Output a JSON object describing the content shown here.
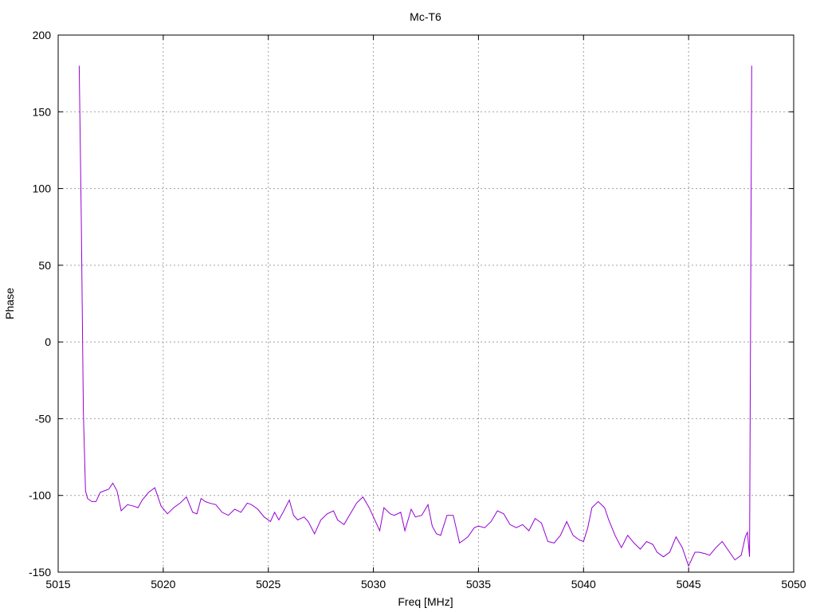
{
  "chart_data": {
    "type": "line",
    "title": "Mc-T6",
    "xlabel": "Freq [MHz]",
    "ylabel": "Phase",
    "xlim": [
      5015,
      5050
    ],
    "ylim": [
      -150,
      200
    ],
    "xticks": [
      5015,
      5020,
      5025,
      5030,
      5035,
      5040,
      5045,
      5050
    ],
    "yticks": [
      -150,
      -100,
      -50,
      0,
      50,
      100,
      150,
      200
    ],
    "grid": true,
    "legend": "none",
    "series": [
      {
        "color": "#9400d3",
        "x": [
          5016.0,
          5016.1,
          5016.2,
          5016.3,
          5016.4,
          5016.6,
          5016.8,
          5017.0,
          5017.2,
          5017.4,
          5017.6,
          5017.8,
          5018.0,
          5018.3,
          5018.6,
          5018.8,
          5019.0,
          5019.3,
          5019.6,
          5019.9,
          5020.2,
          5020.5,
          5020.8,
          5021.1,
          5021.4,
          5021.6,
          5021.8,
          5022.0,
          5022.2,
          5022.5,
          5022.8,
          5023.1,
          5023.4,
          5023.7,
          5024.0,
          5024.2,
          5024.5,
          5024.8,
          5025.1,
          5025.3,
          5025.5,
          5025.7,
          5026.0,
          5026.2,
          5026.4,
          5026.7,
          5026.9,
          5027.2,
          5027.5,
          5027.8,
          5028.1,
          5028.3,
          5028.6,
          5028.9,
          5029.2,
          5029.5,
          5029.8,
          5030.0,
          5030.3,
          5030.5,
          5030.8,
          5031.0,
          5031.3,
          5031.5,
          5031.8,
          5032.0,
          5032.3,
          5032.6,
          5032.8,
          5033.0,
          5033.2,
          5033.5,
          5033.8,
          5034.1,
          5034.3,
          5034.5,
          5034.8,
          5035.0,
          5035.3,
          5035.6,
          5035.9,
          5036.2,
          5036.5,
          5036.8,
          5037.1,
          5037.4,
          5037.7,
          5038.0,
          5038.3,
          5038.6,
          5038.9,
          5039.2,
          5039.5,
          5039.8,
          5040.0,
          5040.2,
          5040.4,
          5040.7,
          5041.0,
          5041.2,
          5041.5,
          5041.8,
          5042.1,
          5042.4,
          5042.7,
          5043.0,
          5043.3,
          5043.5,
          5043.8,
          5044.1,
          5044.4,
          5044.7,
          5045.0,
          5045.3,
          5045.5,
          5045.8,
          5046.0,
          5046.3,
          5046.6,
          5046.9,
          5047.2,
          5047.5,
          5047.7,
          5047.8,
          5047.9,
          5048.0
        ],
        "y": [
          180,
          80,
          -45,
          -97,
          -102,
          -104,
          -104,
          -98,
          -97,
          -96,
          -92,
          -97,
          -110,
          -106,
          -107,
          -108,
          -103,
          -98,
          -95,
          -107,
          -112,
          -108,
          -105,
          -101,
          -111,
          -112,
          -102,
          -104,
          -105,
          -106,
          -111,
          -113,
          -109,
          -111,
          -105,
          -106,
          -109,
          -114,
          -117,
          -111,
          -116,
          -111,
          -103,
          -113,
          -116,
          -114,
          -117,
          -125,
          -116,
          -112,
          -110,
          -116,
          -119,
          -112,
          -105,
          -101,
          -108,
          -114,
          -123,
          -108,
          -112,
          -113,
          -111,
          -123,
          -109,
          -114,
          -113,
          -106,
          -120,
          -125,
          -126,
          -113,
          -113,
          -131,
          -129,
          -127,
          -121,
          -120,
          -121,
          -117,
          -110,
          -112,
          -119,
          -121,
          -119,
          -123,
          -115,
          -118,
          -130,
          -131,
          -126,
          -117,
          -126,
          -129,
          -130,
          -121,
          -108,
          -104,
          -108,
          -116,
          -126,
          -134,
          -126,
          -131,
          -135,
          -130,
          -132,
          -137,
          -140,
          -137,
          -127,
          -134,
          -146,
          -137,
          -137,
          -138,
          -139,
          -134,
          -130,
          -136,
          -142,
          -139,
          -127,
          -124,
          -140,
          180
        ]
      }
    ]
  }
}
